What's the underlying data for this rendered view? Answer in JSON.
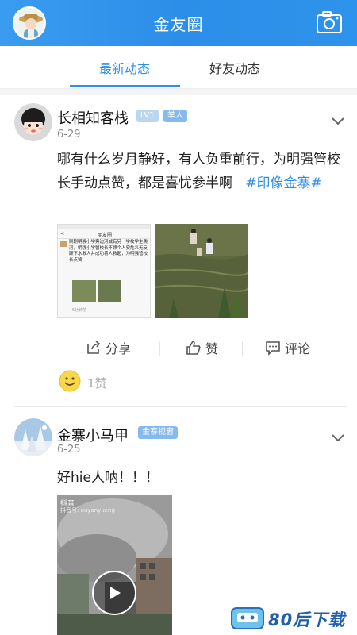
{
  "header": {
    "title": "金友圈",
    "camera_icon": "camera-icon",
    "avatar_icon": "user-avatar"
  },
  "tabs": [
    {
      "label": "最新动态",
      "active": true
    },
    {
      "label": "好友动态",
      "active": false
    }
  ],
  "posts": [
    {
      "name": "长相知客栈",
      "badges": [
        "LV1",
        "举人"
      ],
      "date": "6-29",
      "text": "哪有什么岁月静好，有人负重前行，为明强管校长手动点赞，都是喜忧参半啊",
      "tag": "#印像金寨#",
      "images": [
        {
          "kind": "screenshot",
          "header": "朋友圈",
          "content": "刚刚明强小学旁边河城有另一学校学生跳河，明强小学管校长不顾个人安危义无反顾下水救人并成功将人救起，为明强管校长点赞",
          "footer": "5分钟前"
        },
        {
          "kind": "photo",
          "desc_icon": "flood-photo"
        }
      ],
      "actions": {
        "share": "分享",
        "like": "赞",
        "comment": "评论"
      },
      "likes": "1赞"
    },
    {
      "name": "金寨小马甲",
      "badges": [
        "金寨视窗"
      ],
      "date": "6-25",
      "text": "好hie人呐！！！",
      "video": {
        "app_label": "抖音",
        "account": "抖音号: ouyanyueng"
      }
    }
  ],
  "watermark": {
    "text": "80后下载"
  },
  "colors": {
    "accent": "#2f8fe6",
    "header": "#3a9cf0"
  }
}
